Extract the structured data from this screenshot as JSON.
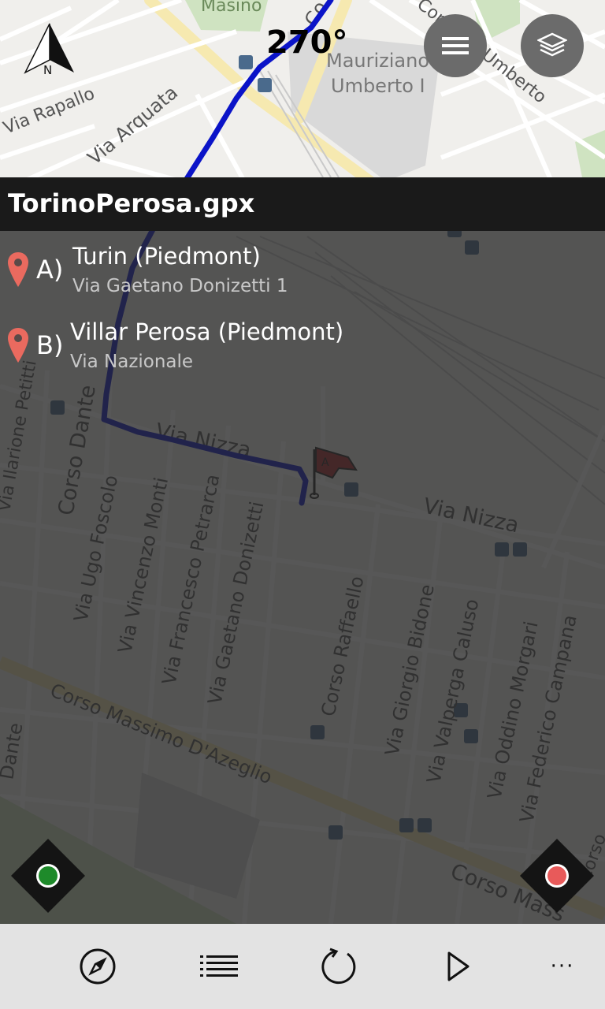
{
  "map": {
    "heading": "270°",
    "labels": {
      "masino": "Masino",
      "mauriziano_1": "Mauriziano",
      "mauriziano_2": "Umberto I",
      "corso_re_umberto": "Corso Re Umberto",
      "via_rapallo": "Via Rapallo",
      "via_arquata": "Via Arquata",
      "corso_top": "Co",
      "via_nizza_left": "Via Nizza",
      "via_nizza_right": "Via Nizza",
      "corso_dante": "Corso Dante",
      "via_ilarione_petitti": "Via Ilarione Petitti",
      "via_ugo_foscolo": "Via Ugo Foscolo",
      "via_vincenzo_monti": "Via Vincenzo Monti",
      "via_francesco_petrarca": "Via Francesco Petrarca",
      "via_gaetano_donizetti": "Via Gaetano Donizetti",
      "corso_raffaello": "Corso Raffaello",
      "via_giorgio_bidone": "Via Giorgio Bidone",
      "via_valperga_caluso": "Via Valperga Caluso",
      "via_oddino_morgari": "Via Oddino Morgari",
      "via_federico_campana": "Via Federico Campana",
      "corso_massimo_dazeglio": "Corso Massimo D'Azeglio",
      "corso_bottom": "Corso Mass",
      "dante_left": "Dante",
      "corso_right": "Corso",
      "compass_n": "N",
      "flag_letter": "A"
    },
    "accent_route": "#0b14c8",
    "accent_pin": "#ea6a5f",
    "start_color": "#1e8a2a",
    "stop_color": "#e85a5a"
  },
  "header": {
    "title": "TorinoPerosa.gpx"
  },
  "waypoints": [
    {
      "letter": "A)",
      "name": "Turin (Piedmont)",
      "address": "Via Gaetano Donizetti 1"
    },
    {
      "letter": "B)",
      "name": "Villar Perosa (Piedmont)",
      "address": "Via Nazionale"
    }
  ],
  "buttons": {
    "menu": "hamburger-menu-icon",
    "layers": "layers-icon",
    "start": "green-dot-icon",
    "record": "red-dot-icon"
  },
  "appbar": {
    "items": [
      "compass-icon",
      "list-icon",
      "refresh-icon",
      "play-icon",
      "more-icon"
    ],
    "more": "···"
  }
}
